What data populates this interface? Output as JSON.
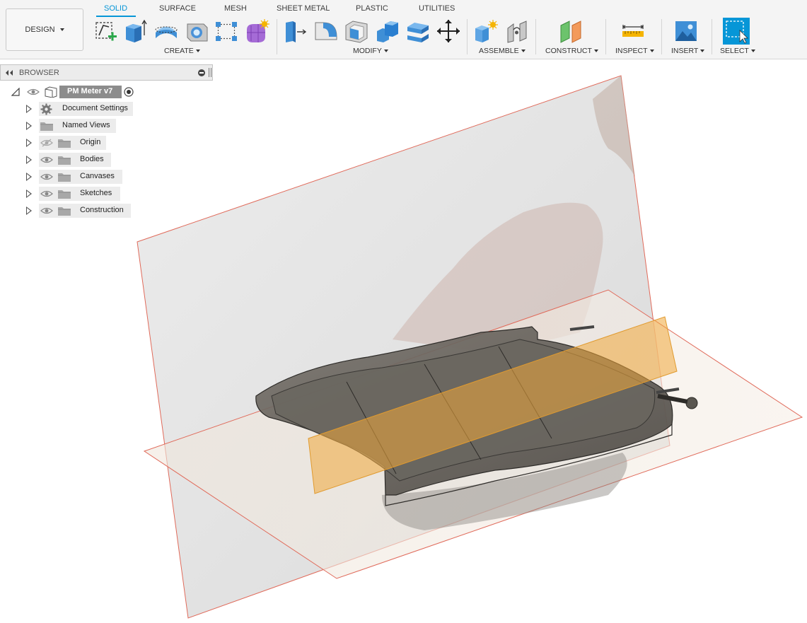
{
  "workspace": {
    "label": "DESIGN"
  },
  "tabs": [
    {
      "label": "SOLID",
      "active": true
    },
    {
      "label": "SURFACE",
      "active": false
    },
    {
      "label": "MESH",
      "active": false
    },
    {
      "label": "SHEET METAL",
      "active": false
    },
    {
      "label": "PLASTIC",
      "active": false
    },
    {
      "label": "UTILITIES",
      "active": false
    }
  ],
  "groups": {
    "create": "CREATE",
    "modify": "MODIFY",
    "assemble": "ASSEMBLE",
    "construct": "CONSTRUCT",
    "inspect": "INSPECT",
    "insert": "INSERT",
    "select": "SELECT"
  },
  "browser": {
    "title": "BROWSER",
    "root": "PM Meter v7",
    "items": [
      {
        "label": "Document Settings",
        "icon": "gear-icon",
        "eye": "none"
      },
      {
        "label": "Named Views",
        "icon": "folder-icon",
        "eye": "none"
      },
      {
        "label": "Origin",
        "icon": "folder-icon",
        "eye": "hidden"
      },
      {
        "label": "Bodies",
        "icon": "folder-icon",
        "eye": "visible"
      },
      {
        "label": "Canvases",
        "icon": "folder-icon",
        "eye": "visible"
      },
      {
        "label": "Sketches",
        "icon": "folder-icon",
        "eye": "visible"
      },
      {
        "label": "Construction",
        "icon": "folder-icon",
        "eye": "visible"
      }
    ]
  },
  "colors": {
    "accent": "#0696d7",
    "plane_edge": "#e06a5a",
    "construction_plane": "#f0a73a",
    "model_body": "#5a5650"
  }
}
